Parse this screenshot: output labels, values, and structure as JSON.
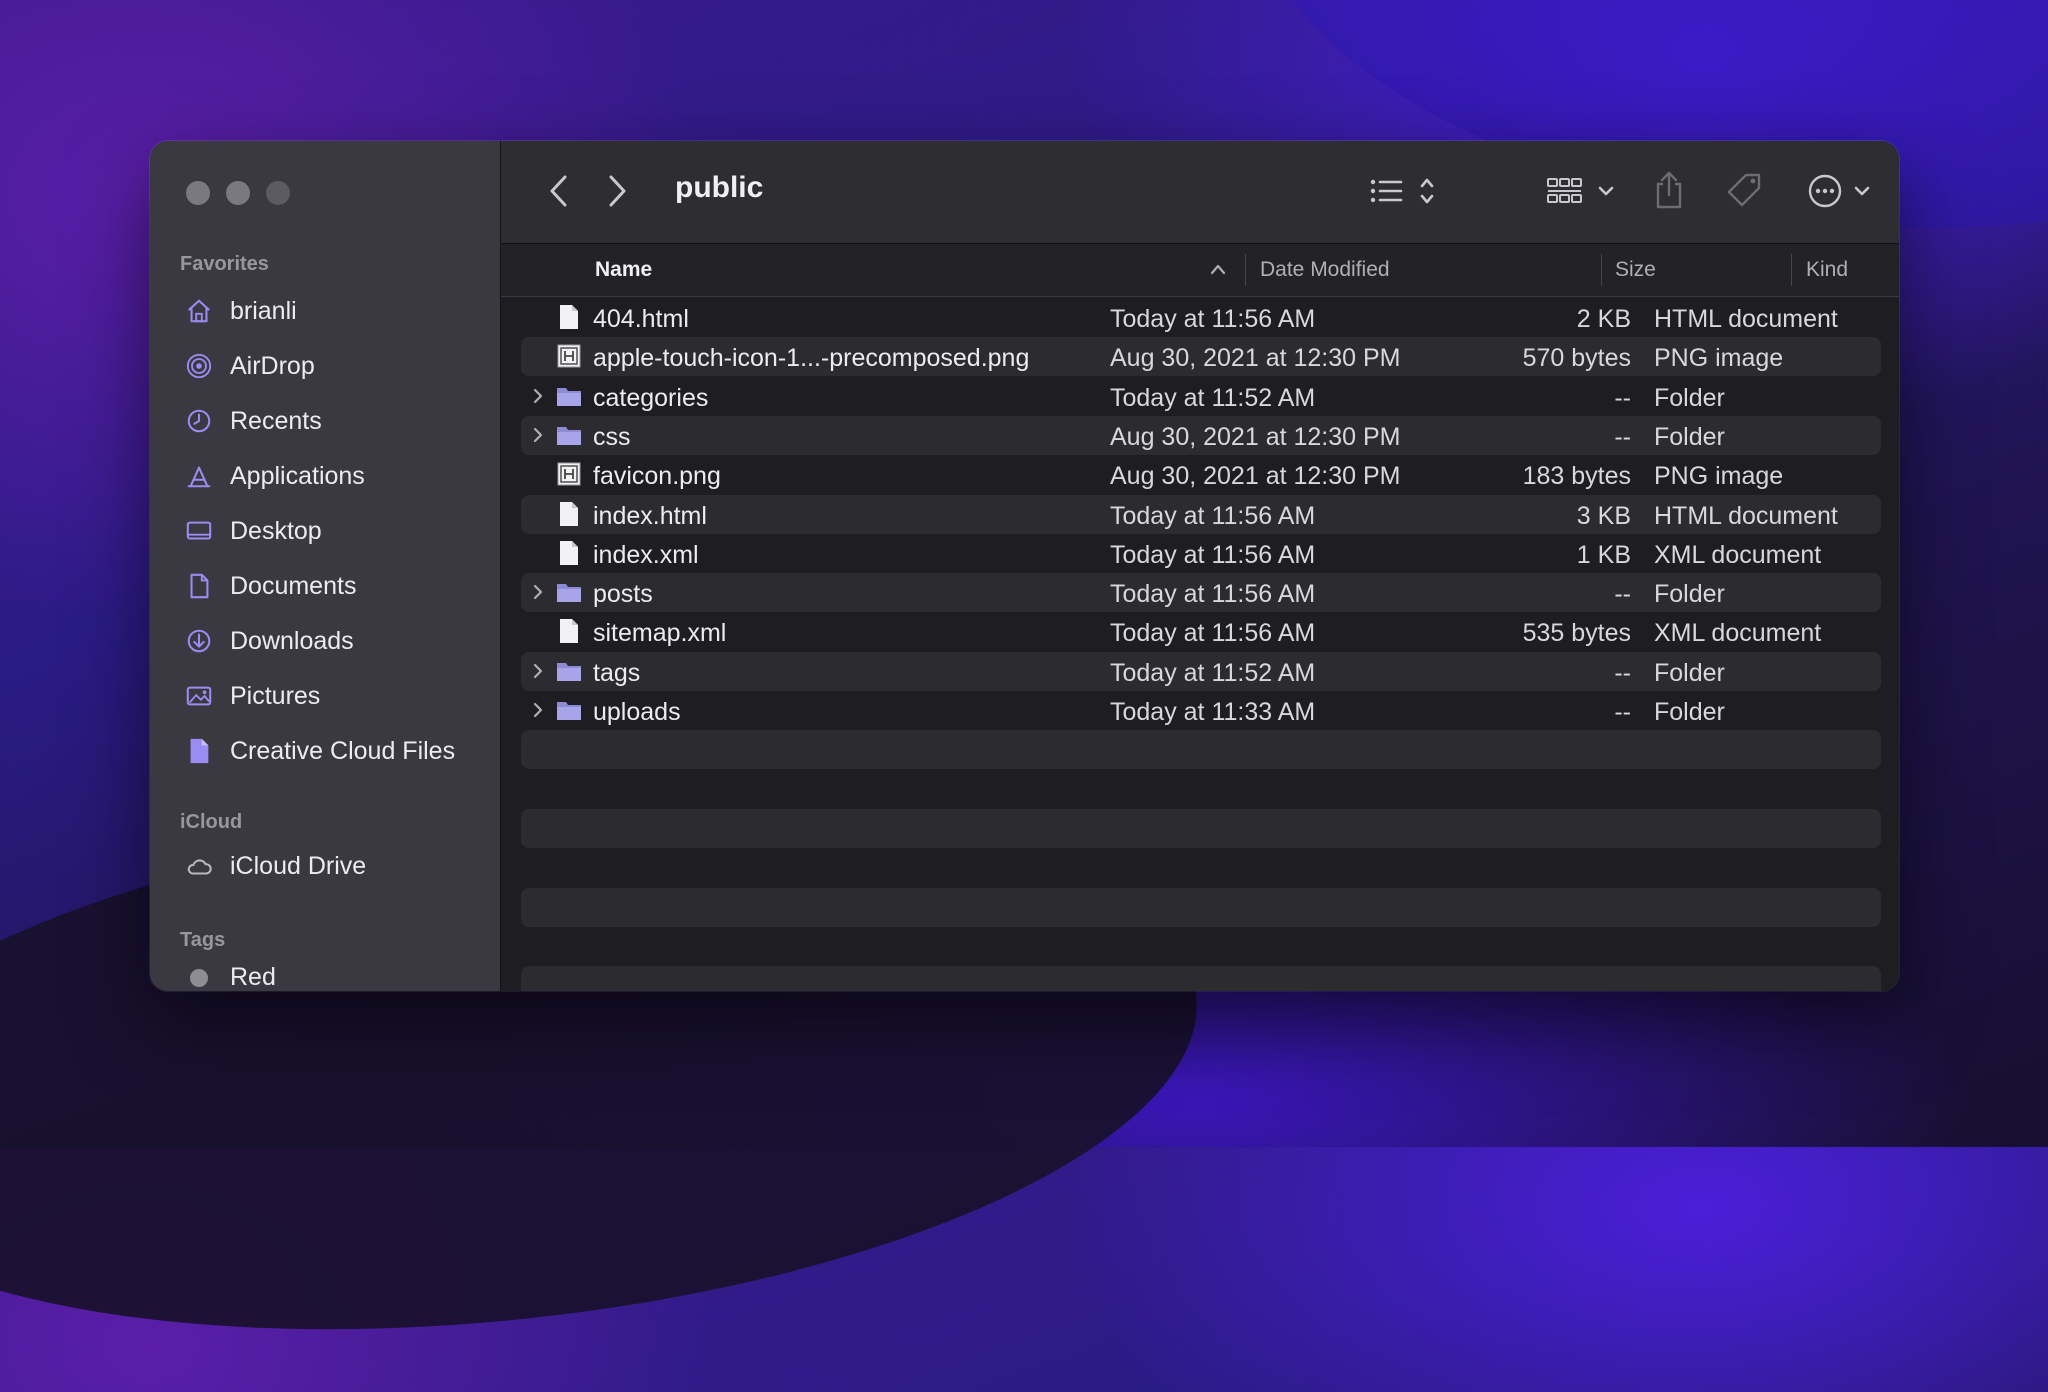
{
  "window": {
    "title": "public"
  },
  "sidebar": {
    "favorites_label": "Favorites",
    "favorites": [
      {
        "label": "brianli",
        "icon": "home-icon"
      },
      {
        "label": "AirDrop",
        "icon": "airdrop-icon"
      },
      {
        "label": "Recents",
        "icon": "clock-icon"
      },
      {
        "label": "Applications",
        "icon": "applications-icon"
      },
      {
        "label": "Desktop",
        "icon": "desktop-icon"
      },
      {
        "label": "Documents",
        "icon": "document-icon"
      },
      {
        "label": "Downloads",
        "icon": "download-icon"
      },
      {
        "label": "Pictures",
        "icon": "picture-icon"
      },
      {
        "label": "Creative Cloud Files",
        "icon": "creative-cloud-icon"
      }
    ],
    "icloud_label": "iCloud",
    "icloud": [
      {
        "label": "iCloud Drive",
        "icon": "cloud-icon"
      }
    ],
    "tags_label": "Tags",
    "tags": [
      {
        "label": "Red",
        "color": "#8e8d93"
      }
    ]
  },
  "header": {
    "name": "Name",
    "date_modified": "Date Modified",
    "size": "Size",
    "kind": "Kind"
  },
  "files": [
    {
      "name": "404.html",
      "date": "Today at 11:56 AM",
      "size": "2 KB",
      "kind": "HTML document",
      "type": "file"
    },
    {
      "name": "apple-touch-icon-1...-precomposed.png",
      "date": "Aug 30, 2021 at 12:30 PM",
      "size": "570 bytes",
      "kind": "PNG image",
      "type": "image"
    },
    {
      "name": "categories",
      "date": "Today at 11:52 AM",
      "size": "--",
      "kind": "Folder",
      "type": "folder"
    },
    {
      "name": "css",
      "date": "Aug 30, 2021 at 12:30 PM",
      "size": "--",
      "kind": "Folder",
      "type": "folder"
    },
    {
      "name": "favicon.png",
      "date": "Aug 30, 2021 at 12:30 PM",
      "size": "183 bytes",
      "kind": "PNG image",
      "type": "image"
    },
    {
      "name": "index.html",
      "date": "Today at 11:56 AM",
      "size": "3 KB",
      "kind": "HTML document",
      "type": "file"
    },
    {
      "name": "index.xml",
      "date": "Today at 11:56 AM",
      "size": "1 KB",
      "kind": "XML document",
      "type": "file"
    },
    {
      "name": "posts",
      "date": "Today at 11:56 AM",
      "size": "--",
      "kind": "Folder",
      "type": "folder"
    },
    {
      "name": "sitemap.xml",
      "date": "Today at 11:56 AM",
      "size": "535 bytes",
      "kind": "XML document",
      "type": "file"
    },
    {
      "name": "tags",
      "date": "Today at 11:52 AM",
      "size": "--",
      "kind": "Folder",
      "type": "folder"
    },
    {
      "name": "uploads",
      "date": "Today at 11:33 AM",
      "size": "--",
      "kind": "Folder",
      "type": "folder"
    }
  ],
  "colors": {
    "accent": "#9a8cf0",
    "folder": "#8e8bd6"
  }
}
